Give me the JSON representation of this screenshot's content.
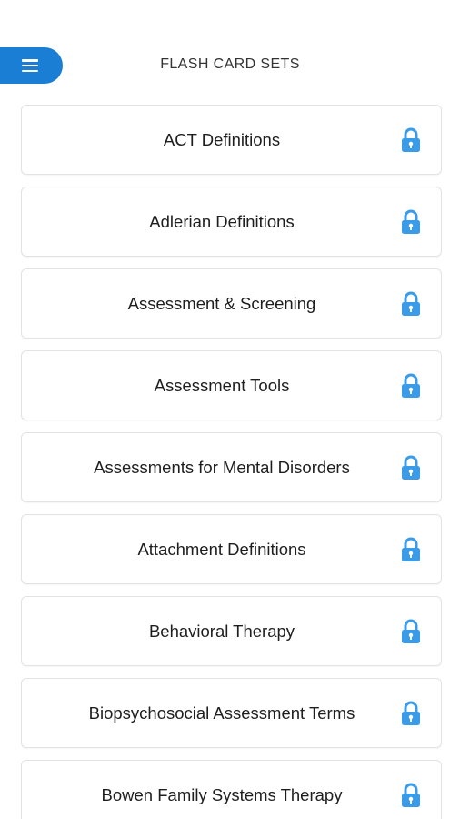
{
  "header": {
    "title": "FLASH CARD SETS",
    "menu_icon": "hamburger-menu-icon"
  },
  "colors": {
    "accent": "#1a7fd4",
    "lock": "#3a9be8",
    "card_border": "#e3e3e3",
    "text": "#1e1e1e"
  },
  "card_sets": [
    {
      "label": "ACT Definitions",
      "icon": "lock-icon"
    },
    {
      "label": "Adlerian Definitions",
      "icon": "lock-icon"
    },
    {
      "label": "Assessment & Screening",
      "icon": "lock-icon"
    },
    {
      "label": "Assessment Tools",
      "icon": "lock-icon"
    },
    {
      "label": "Assessments for Mental Disorders",
      "icon": "lock-icon"
    },
    {
      "label": "Attachment Definitions",
      "icon": "lock-icon"
    },
    {
      "label": "Behavioral Therapy",
      "icon": "lock-icon"
    },
    {
      "label": "Biopsychosocial Assessment Terms",
      "icon": "lock-icon"
    },
    {
      "label": "Bowen Family Systems Therapy",
      "icon": "lock-icon"
    }
  ]
}
